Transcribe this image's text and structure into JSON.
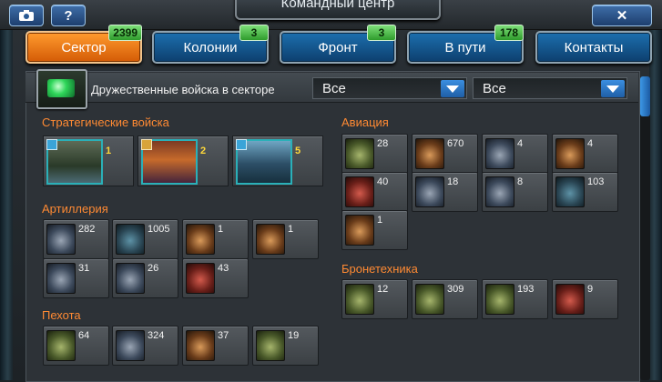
{
  "window": {
    "title": "Командный центр"
  },
  "topbar": {
    "screenshot_icon": "camera-icon",
    "help_label": "?",
    "close_label": "✕"
  },
  "tabs": [
    {
      "label": "Сектор",
      "badge": "2399",
      "active": true
    },
    {
      "label": "Колонии",
      "badge": "3",
      "active": false
    },
    {
      "label": "Фронт",
      "badge": "3",
      "active": false
    },
    {
      "label": "В пути",
      "badge": "178",
      "active": false
    },
    {
      "label": "Контакты",
      "badge": "",
      "active": false
    }
  ],
  "filter": {
    "label": "Дружественные войска в секторе",
    "select1": "Все",
    "select2": "Все"
  },
  "sections": {
    "strategic": {
      "title": "Стратегические войска",
      "items": [
        "1",
        "2",
        "5"
      ]
    },
    "artillery": {
      "title": "Артиллерия",
      "items": [
        "282",
        "1005",
        "1",
        "1",
        "31",
        "26",
        "43"
      ]
    },
    "infantry": {
      "title": "Пехота",
      "items": [
        "64",
        "324",
        "37",
        "19"
      ]
    },
    "aviation": {
      "title": "Авиация",
      "items": [
        "28",
        "670",
        "4",
        "4",
        "40",
        "18",
        "8",
        "103",
        "1"
      ]
    },
    "armor": {
      "title": "Бронетехника",
      "items": [
        "12",
        "309",
        "193",
        "9"
      ]
    }
  }
}
